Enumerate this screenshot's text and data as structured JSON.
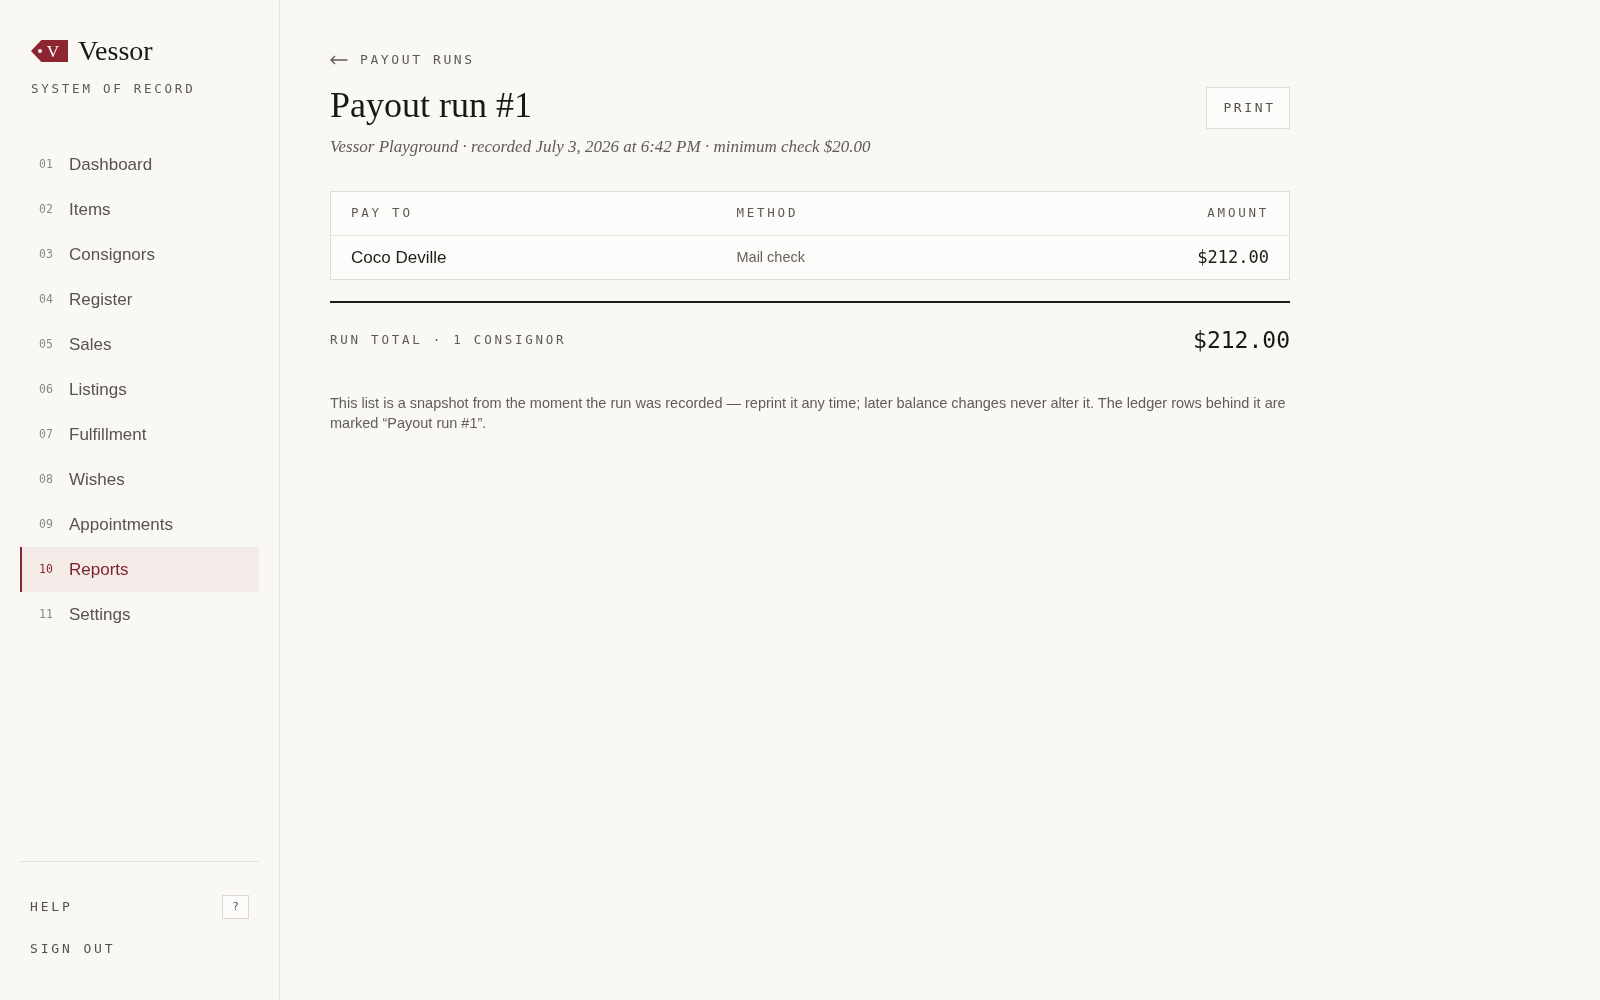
{
  "sidebar": {
    "brand": {
      "mark": "V",
      "name": "Vessor",
      "tagline": "SYSTEM OF RECORD"
    },
    "nav": [
      {
        "number": "01",
        "label": "Dashboard",
        "selected": false
      },
      {
        "number": "02",
        "label": "Items",
        "selected": false
      },
      {
        "number": "03",
        "label": "Consignors",
        "selected": false
      },
      {
        "number": "04",
        "label": "Register",
        "selected": false
      },
      {
        "number": "05",
        "label": "Sales",
        "selected": false
      },
      {
        "number": "06",
        "label": "Listings",
        "selected": false
      },
      {
        "number": "07",
        "label": "Fulfillment",
        "selected": false
      },
      {
        "number": "08",
        "label": "Wishes",
        "selected": false
      },
      {
        "number": "09",
        "label": "Appointments",
        "selected": false
      },
      {
        "number": "10",
        "label": "Reports",
        "selected": true
      },
      {
        "number": "11",
        "label": "Settings",
        "selected": false
      }
    ],
    "footer": [
      {
        "label": "HELP",
        "shortcut": "?"
      },
      {
        "label": "SIGN OUT"
      }
    ]
  },
  "header": {
    "back_link": "PAYOUT RUNS",
    "title": "Payout run #1",
    "subtitle": "Vessor Playground · recorded July 3, 2026 at 6:42 PM · minimum check $20.00",
    "print_button": "PRINT"
  },
  "table": {
    "columns": [
      "PAY TO",
      "METHOD",
      "AMOUNT"
    ],
    "rows": [
      {
        "cells": [
          "Coco Deville",
          "Mail check",
          "$212.00"
        ]
      }
    ]
  },
  "total": {
    "label": "RUN TOTAL · 1 CONSIGNOR",
    "amount": "$212.00"
  },
  "note": "This list is a snapshot from the moment the run was recorded — reprint it any time; later balance changes never alter it. The ledger rows behind it are marked “Payout run #1”."
}
